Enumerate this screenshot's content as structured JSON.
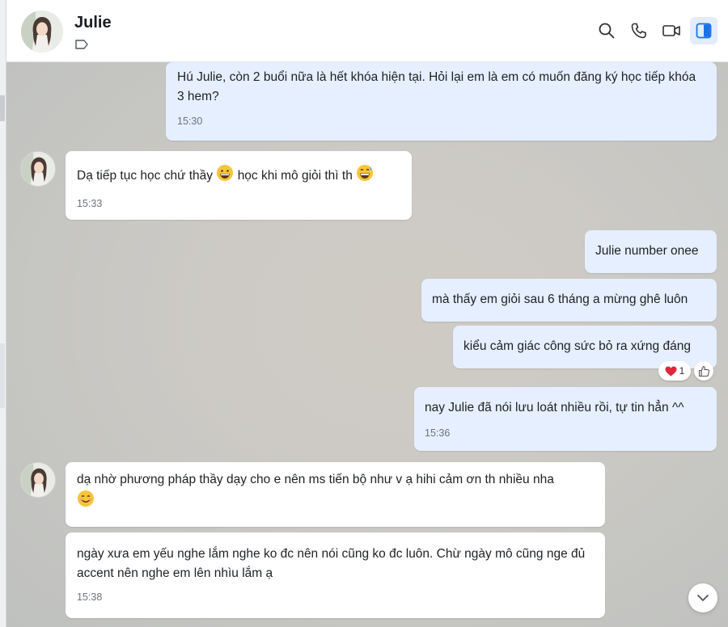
{
  "contact": {
    "name": "Julie",
    "avatar_icon": "girl-portrait-avatar"
  },
  "header_icons": [
    "tag-icon",
    "search-icon",
    "phone-icon",
    "video-icon",
    "sidebar-toggle-icon"
  ],
  "messages": [
    {
      "id": "m1",
      "direction": "out",
      "text": "Hú Julie, còn 2 buổi nữa là hết khóa hiện tại. Hỏi lại em là em có muốn đăng ký học tiếp khóa 3 hem?",
      "time": "15:30"
    },
    {
      "id": "m2",
      "direction": "in",
      "text_a": "Dạ tiếp tục học chứ thầy",
      "text_b": "học khi mô giỏi thì th",
      "emojis": [
        "grinning-face",
        "grinning-sweat-face"
      ],
      "time": "15:33"
    },
    {
      "id": "m3",
      "direction": "out",
      "text": "Julie number onee"
    },
    {
      "id": "m4",
      "direction": "out",
      "text": "mà thấy em giỏi sau 6 tháng a mừng ghê luôn"
    },
    {
      "id": "m5",
      "direction": "out",
      "text": "kiểu cảm giác công sức bỏ ra xứng đáng",
      "reaction": {
        "emoji": "heart",
        "count": "1"
      }
    },
    {
      "id": "m6",
      "direction": "out",
      "text": "nay Julie đã nói lưu loát nhiều rồi, tự tin hẳn ^^",
      "time": "15:36"
    },
    {
      "id": "m7",
      "direction": "in",
      "text": "dạ nhờ phương pháp thầy dạy cho e nên ms tiến bộ như v ạ hihi cảm ơn th nhiều nha",
      "emojis": [
        "smiling-face"
      ]
    },
    {
      "id": "m8",
      "direction": "in",
      "text": "ngày xưa em yếu nghe lắm nghe ko đc nên nói cũng ko đc luôn. Chừ ngày mô cũng nge đủ accent nên nghe em lên nhìu lắm ạ",
      "time": "15:38"
    }
  ],
  "colors": {
    "outgoing_bubble": "#e5efff",
    "incoming_bubble": "#ffffff",
    "accent": "#1a73e8"
  }
}
